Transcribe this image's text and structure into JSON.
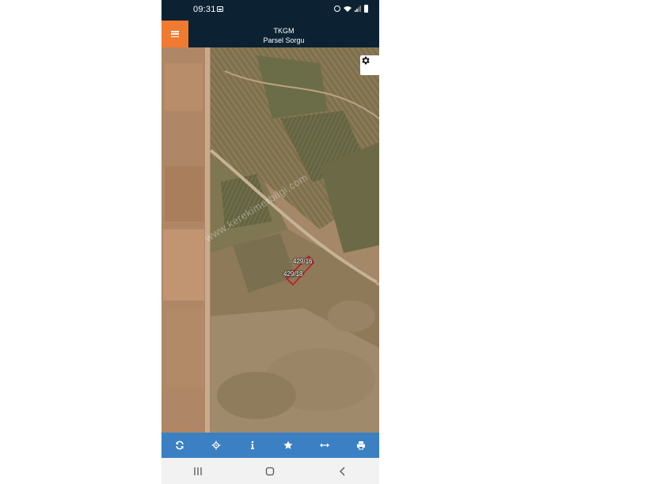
{
  "status_bar": {
    "time": "09:31"
  },
  "header": {
    "title": "TKGM",
    "subtitle": "Parsel Sorgu"
  },
  "map": {
    "parcel_labels": [
      "429/16",
      "429/18"
    ],
    "watermark": "www.kerekimerbilgi.com",
    "highlight_color": "#c0182a"
  },
  "toolbar": {
    "buttons": [
      {
        "icon": "refresh-icon"
      },
      {
        "icon": "locate-icon"
      },
      {
        "icon": "info-icon"
      },
      {
        "icon": "star-icon"
      },
      {
        "icon": "measure-icon"
      },
      {
        "icon": "print-icon"
      }
    ]
  },
  "nav_bar": {
    "buttons": [
      "recent-apps",
      "home",
      "back"
    ]
  },
  "colors": {
    "header": "#0c2233",
    "menu": "#f07a2f",
    "toolbar": "#3a80c2"
  }
}
